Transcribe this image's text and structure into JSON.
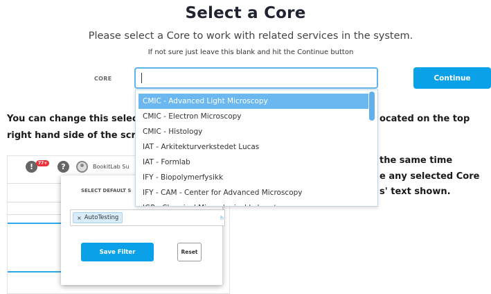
{
  "header": {
    "title": "Select a Core",
    "subtitle": "Please select a Core to work with related services in the system.",
    "hint": "If not sure just leave this blank and hit the Continue button"
  },
  "core_field": {
    "label": "CORE",
    "value": "",
    "continue_label": "Continue"
  },
  "dropdown": {
    "options": [
      "CMIC - Advanced Light Microscopy",
      "CMIC - Electron Microscopy",
      "CMIC - Histology",
      "IAT - Arkitekturverkstedet Lucas",
      "IAT - Formlab",
      "IFY - Biopolymerfysikk",
      "IFY - CAM - Center for Advanced Microscopy",
      "IGP - Chemical Mineralogical Laboratory"
    ],
    "selected_index": 0
  },
  "info": {
    "left_line1": "You can change this select",
    "left_line2": "right hand side of the scre",
    "right_line1": "ocated on the top",
    "right_line3": "the same time",
    "right_line4": "e any selected Core",
    "right_line5": "s' text shown."
  },
  "inset": {
    "badge": "77+",
    "info_glyph": "!",
    "help_glyph": "?",
    "user_name": "BookitLab Su",
    "filter_label": "SELECT DEFAULT S",
    "tag_label": "AutoTesting",
    "tag_remove": "×",
    "search_ghost": "h",
    "save_label": "Save Filter",
    "reset_label": "Reset"
  },
  "colors": {
    "accent": "#0aa1e8",
    "selected_option": "#6ab8ef",
    "input_border": "#5fb3ec",
    "badge": "#e8333b"
  }
}
